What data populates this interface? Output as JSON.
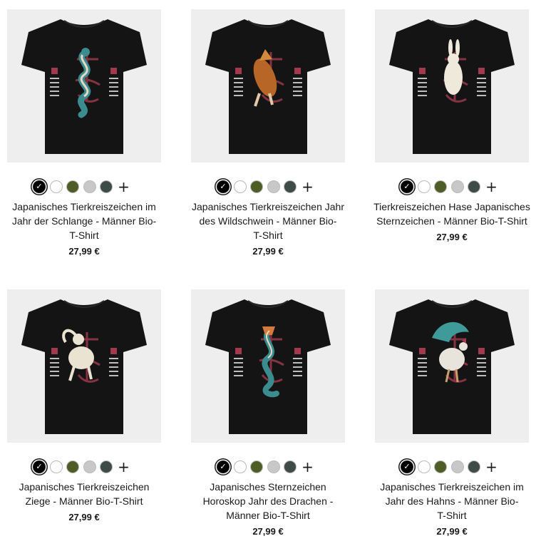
{
  "colors": {
    "card_bg": "#eeeeee",
    "shirt": "#141414",
    "swatch_black": "#000000",
    "swatch_white": "#ffffff",
    "swatch_olive": "#4e5d25",
    "swatch_grey": "#c8c8c8",
    "swatch_dark_green": "#3f4b47",
    "accent_red": "#a23a4e"
  },
  "swatch_options": [
    "black",
    "white",
    "olive",
    "light-grey",
    "dark-green-grey"
  ],
  "selected_swatch": "black",
  "more_colors_icon": "plus-icon",
  "selected_icon": "check-icon",
  "products": [
    {
      "animal": "snake",
      "title": "Japanisches Tierkreiszeichen im Jahr der Schlange - Männer Bio-T-Shirt",
      "title_lines": [
        "Japanisches Tierkreiszeichen im",
        "Jahr der Schlange - Männer Bio-",
        "T-Shirt"
      ],
      "price": "27,99 €"
    },
    {
      "animal": "boar",
      "title": "Japanisches Tierkreiszeichen Jahr des Wildschwein - Männer Bio-T-Shirt",
      "title_lines": [
        "Japanisches Tierkreiszeichen Jahr",
        "des Wildschwein - Männer Bio-",
        "T-Shirt"
      ],
      "price": "27,99 €"
    },
    {
      "animal": "rabbit",
      "title": "Tierkreiszeichen Hase Japanisches Sternzeichen - Männer Bio-T-Shirt",
      "title_lines": [
        "Tierkreiszeichen Hase Japanisches",
        "Sternzeichen - Männer Bio-T-Shirt"
      ],
      "price": "27,99 €"
    },
    {
      "animal": "goat",
      "title": "Japanisches Tierkreiszeichen Ziege - Männer Bio-T-Shirt",
      "title_lines": [
        "Japanisches Tierkreiszeichen",
        "Ziege - Männer Bio-T-Shirt"
      ],
      "price": "27,99 €"
    },
    {
      "animal": "dragon",
      "title": "Japanisches Sternzeichen Horoskop Jahr des Drachen - Männer Bio-T-Shirt",
      "title_lines": [
        "Japanisches Sternzeichen",
        "Horoskop Jahr des Drachen -",
        "Männer Bio-T-Shirt"
      ],
      "price": "27,99 €"
    },
    {
      "animal": "rooster",
      "title": "Japanisches Tierkreiszeichen im Jahr des Hahns - Männer Bio-T-Shirt",
      "title_lines": [
        "Japanisches Tierkreiszeichen im",
        "Jahr des Hahns - Männer Bio-",
        "T-Shirt"
      ],
      "price": "27,99 €"
    }
  ]
}
